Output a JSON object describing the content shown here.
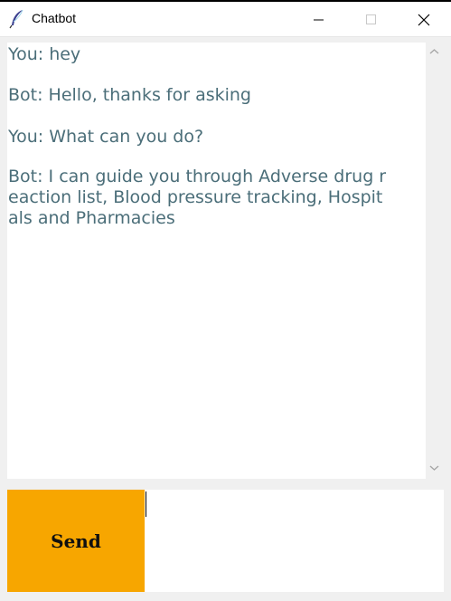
{
  "window": {
    "title": "Chatbot",
    "icons": {
      "app": "feather-icon",
      "minimize": "minimize-icon",
      "maximize": "maximize-icon",
      "close": "close-icon"
    }
  },
  "chat": {
    "messages": [
      {
        "lines": [
          "You: hey"
        ]
      },
      {
        "lines": [
          "Bot: Hello, thanks for asking"
        ]
      },
      {
        "lines": [
          "You: What can you do?"
        ]
      },
      {
        "lines": [
          "Bot: I can guide you through Adverse drug r",
          "eaction list, Blood pressure tracking, Hospit",
          "als and Pharmacies"
        ]
      }
    ],
    "text_color": "#4b6e79"
  },
  "input": {
    "value": ""
  },
  "send_button": {
    "label": "Send",
    "color": "#f7a600"
  }
}
